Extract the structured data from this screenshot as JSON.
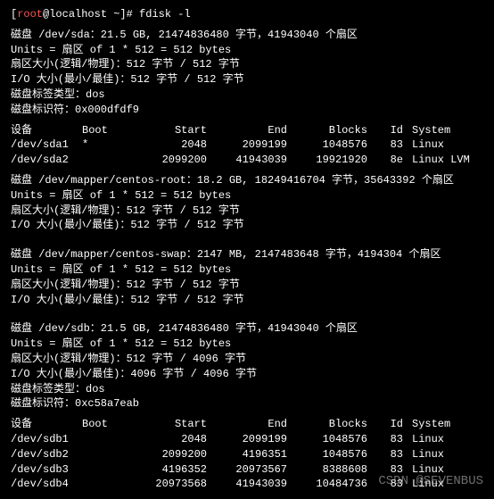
{
  "prompt": {
    "user": "root",
    "at": "@",
    "host": "localhost",
    "path": " ~]# ",
    "command": "fdisk -l"
  },
  "disk_sda": {
    "line1": "磁盘 /dev/sda：21.5 GB, 21474836480 字节，41943040 个扇区",
    "line2": "Units = 扇区 of 1 * 512 = 512 bytes",
    "line3": "扇区大小(逻辑/物理)：512 字节 / 512 字节",
    "line4": "I/O 大小(最小/最佳)：512 字节 / 512 字节",
    "line5": "磁盘标签类型：dos",
    "line6": "磁盘标识符：0x000dfdf9"
  },
  "header": {
    "device": "   设备",
    "boot": "Boot",
    "start": "Start",
    "end": "End",
    "blocks": "Blocks",
    "id": "Id",
    "system": "System"
  },
  "sda_rows": [
    {
      "device": "/dev/sda1",
      "boot": "*",
      "start": "2048",
      "end": "2099199",
      "blocks": "1048576",
      "id": "83",
      "system": "Linux"
    },
    {
      "device": "/dev/sda2",
      "boot": "",
      "start": "2099200",
      "end": "41943039",
      "blocks": "19921920",
      "id": "8e",
      "system": "Linux LVM"
    }
  ],
  "disk_root": {
    "line1": "磁盘 /dev/mapper/centos-root：18.2 GB, 18249416704 字节，35643392 个扇区",
    "line2": "Units = 扇区 of 1 * 512 = 512 bytes",
    "line3": "扇区大小(逻辑/物理)：512 字节 / 512 字节",
    "line4": "I/O 大小(最小/最佳)：512 字节 / 512 字节"
  },
  "disk_swap": {
    "line1": "磁盘 /dev/mapper/centos-swap：2147 MB, 2147483648 字节，4194304 个扇区",
    "line2": "Units = 扇区 of 1 * 512 = 512 bytes",
    "line3": "扇区大小(逻辑/物理)：512 字节 / 512 字节",
    "line4": "I/O 大小(最小/最佳)：512 字节 / 512 字节"
  },
  "disk_sdb": {
    "line1": "磁盘 /dev/sdb：21.5 GB, 21474836480 字节，41943040 个扇区",
    "line2": "Units = 扇区 of 1 * 512 = 512 bytes",
    "line3": "扇区大小(逻辑/物理)：512 字节 / 4096 字节",
    "line4": "I/O 大小(最小/最佳)：4096 字节 / 4096 字节",
    "line5": "磁盘标签类型：dos",
    "line6": "磁盘标识符：0xc58a7eab"
  },
  "sdb_rows": [
    {
      "device": "/dev/sdb1",
      "boot": "",
      "start": "2048",
      "end": "2099199",
      "blocks": "1048576",
      "id": "83",
      "system": "Linux"
    },
    {
      "device": "/dev/sdb2",
      "boot": "",
      "start": "2099200",
      "end": "4196351",
      "blocks": "1048576",
      "id": "83",
      "system": "Linux"
    },
    {
      "device": "/dev/sdb3",
      "boot": "",
      "start": "4196352",
      "end": "20973567",
      "blocks": "8388608",
      "id": "83",
      "system": "Linux"
    },
    {
      "device": "/dev/sdb4",
      "boot": "",
      "start": "20973568",
      "end": "41943039",
      "blocks": "10484736",
      "id": "83",
      "system": "Linux"
    }
  ],
  "watermark": "CSDN @SEVENBUS"
}
